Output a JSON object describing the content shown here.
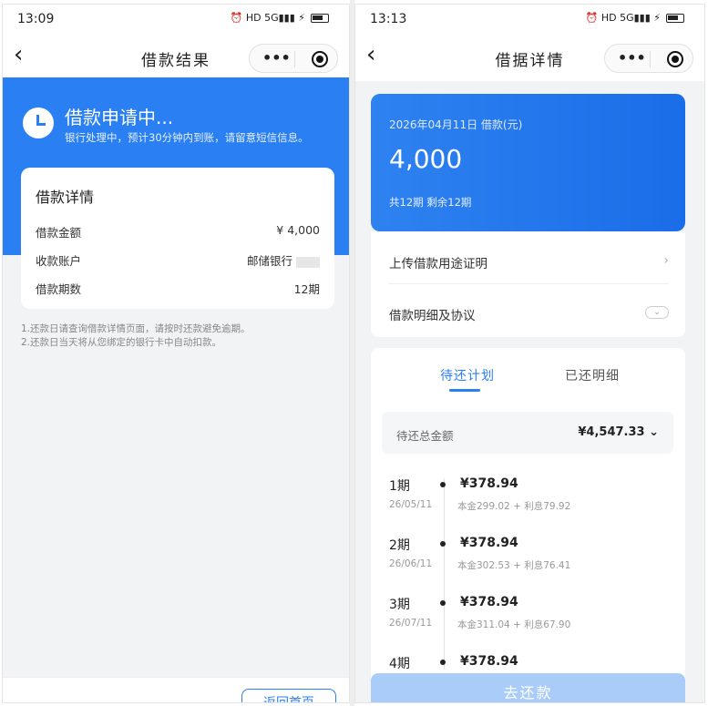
{
  "left": {
    "status": {
      "time": "13:09",
      "icons": "⏰ HD 5G▮▮▮ ⚡"
    },
    "nav": {
      "title": "借款结果"
    },
    "banner": {
      "title": "借款申请中...",
      "subtitle": "银行处理中，预计30分钟内到账，请留意短信信息。"
    },
    "card": {
      "title": "借款详情",
      "rows": [
        {
          "label": "借款金额",
          "value": "¥ 4,000"
        },
        {
          "label": "收款账户",
          "value": "邮储银行"
        },
        {
          "label": "借款期数",
          "value": "12期"
        }
      ]
    },
    "notes": [
      "1.还款日请查询借款详情页面，请按时还款避免逾期。",
      "2.还款日当天将从您绑定的银行卡中自动扣款。"
    ],
    "home_button": "返回首页"
  },
  "right": {
    "status": {
      "time": "13:13",
      "icons": "⏰ HD 5G▮▮▮ ⚡"
    },
    "nav": {
      "title": "借据详情"
    },
    "loan": {
      "date": "2026年04月11日 借款(元)",
      "amount": "4,000",
      "terms": "共12期  剩余12期"
    },
    "links": [
      {
        "label": "上传借款用途证明"
      },
      {
        "label": "借款明细及协议"
      }
    ],
    "tabs": [
      {
        "label": "待还计划",
        "active": true
      },
      {
        "label": "已还明细",
        "active": false
      }
    ],
    "total": {
      "label": "待还总金额",
      "value": "¥4,547.33 ⌄"
    },
    "schedule": [
      {
        "period": "1期",
        "date": "26/05/11",
        "amount": "¥378.94",
        "detail": "本金299.02 + 利息79.92"
      },
      {
        "period": "2期",
        "date": "26/06/11",
        "amount": "¥378.94",
        "detail": "本金302.53 + 利息76.41"
      },
      {
        "period": "3期",
        "date": "26/07/11",
        "amount": "¥378.94",
        "detail": "本金311.04 + 利息67.90"
      },
      {
        "period": "4期",
        "date": "",
        "amount": "¥378.94",
        "detail": ""
      }
    ],
    "repay_button": "去还款"
  },
  "colors": {
    "accent": "#2a7ff3",
    "button_disabled": "#a9ccf8"
  }
}
